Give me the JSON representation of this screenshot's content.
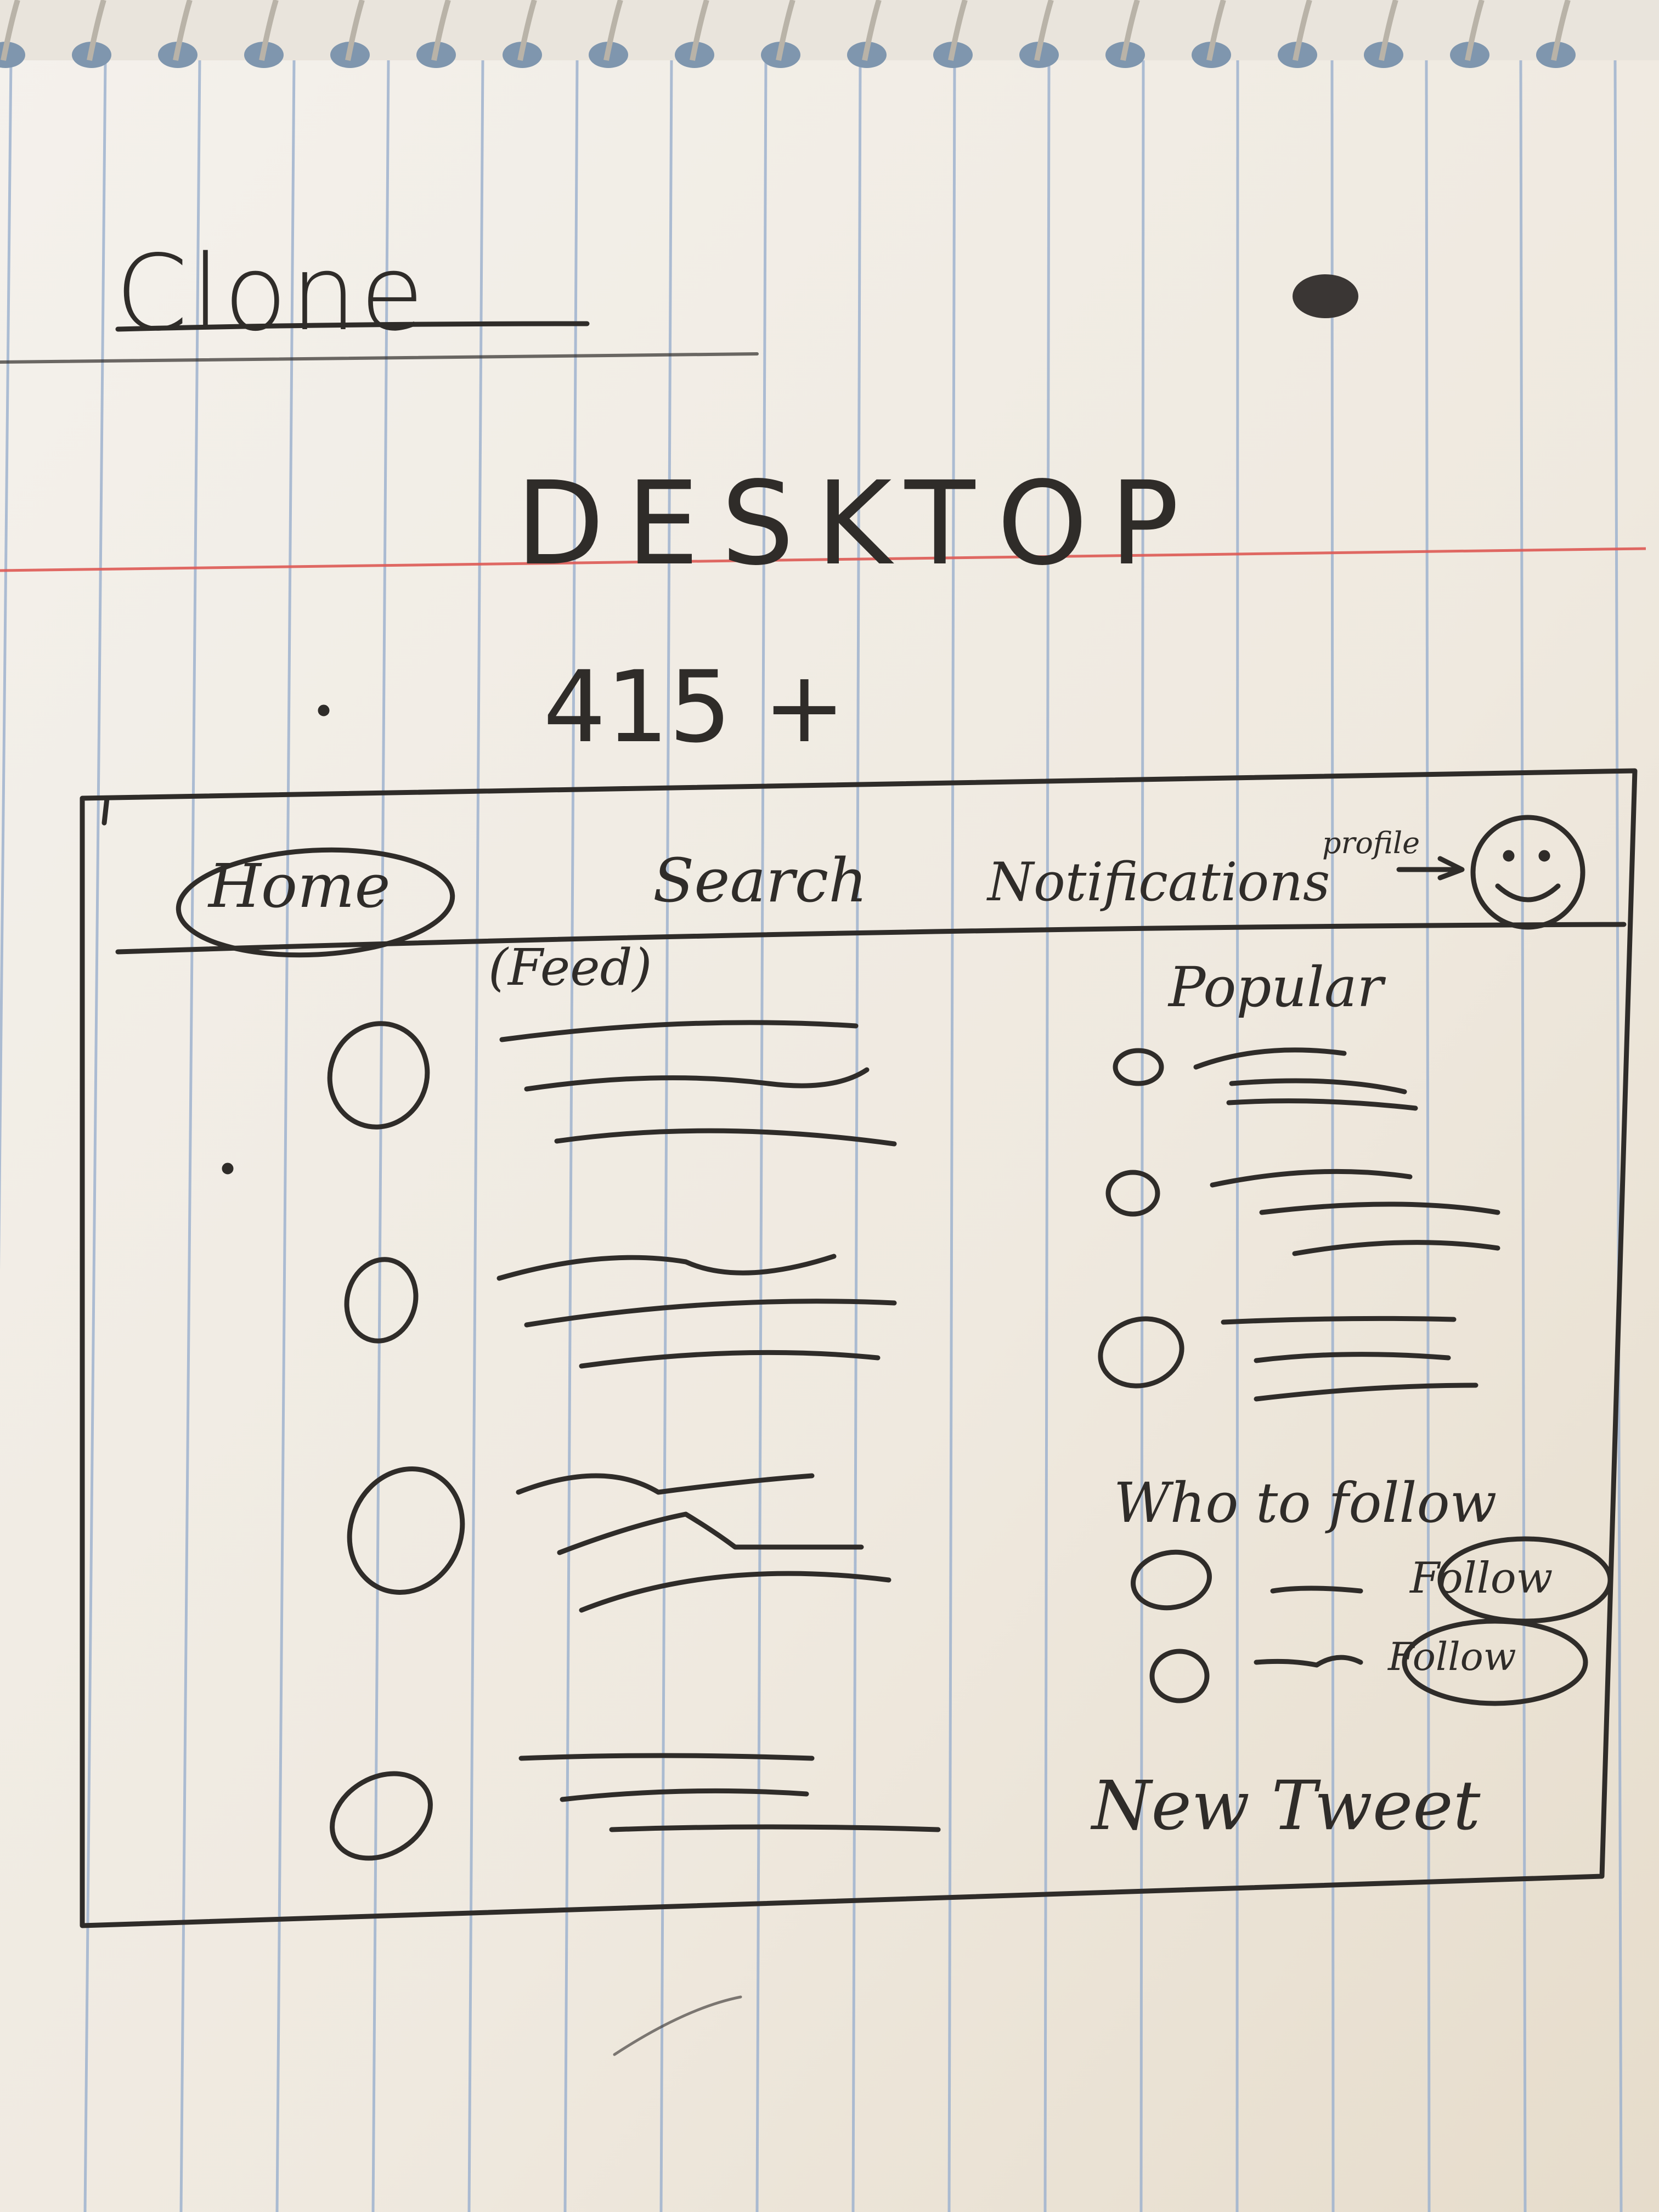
{
  "page": {
    "title": "Clone",
    "layout_label": "DESKTOP",
    "breakpoint": "415 +"
  },
  "header": {
    "nav_items": [
      {
        "label": "Home",
        "active": true
      },
      {
        "label": "Search",
        "active": false
      },
      {
        "label": "Notifications",
        "active": false
      }
    ],
    "profile_label": "profile",
    "profile_arrow": "→",
    "profile_icon": "smiley-face-icon"
  },
  "feed": {
    "label": "(Feed)",
    "item_count": 4
  },
  "sidebar": {
    "popular": {
      "heading": "Popular",
      "item_count": 3
    },
    "who_to_follow": {
      "heading": "Who to follow",
      "suggestions": [
        {
          "button_label": "Follow"
        },
        {
          "button_label": "Follow"
        }
      ]
    },
    "new_tweet_label": "New Tweet"
  },
  "colors": {
    "paper": "#f3efe8",
    "ink": "#2f2c29",
    "rule_blue": "#8fa8c8",
    "margin_red": "#d9534f"
  }
}
